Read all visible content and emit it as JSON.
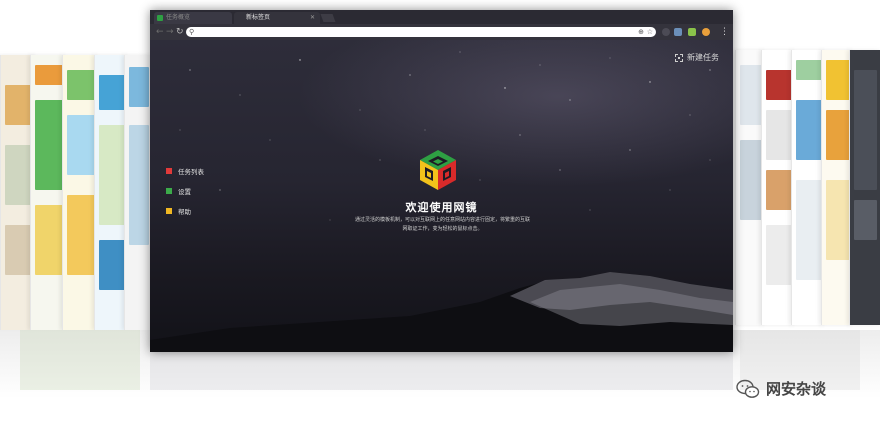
{
  "browser": {
    "tabs": [
      {
        "label": "任务概览",
        "active": false
      },
      {
        "label": "新标签页",
        "active": true
      }
    ],
    "address_value": "",
    "extension_icons": [
      "shield-icon",
      "mail-icon",
      "green-ext-icon",
      "orange-ext-icon"
    ]
  },
  "page": {
    "new_task_label": "新建任务",
    "menu": [
      {
        "label": "任务列表",
        "color": "#e13a3a"
      },
      {
        "label": "设置",
        "color": "#3cab4a"
      },
      {
        "label": "帮助",
        "color": "#f0b723"
      }
    ],
    "welcome_title": "欢迎使用网镜",
    "description_line1": "通过灵活的模板机制，可以对互联网上的任意网站内容进行固定，将繁重的互联",
    "description_line2": "网取证工作，变为轻松的鼠标点击。"
  },
  "watermark": {
    "text": "网安杂谈"
  },
  "colors": {
    "logo_green": "#2ea043",
    "logo_red": "#d82a2a",
    "logo_yellow": "#f2c21b"
  }
}
